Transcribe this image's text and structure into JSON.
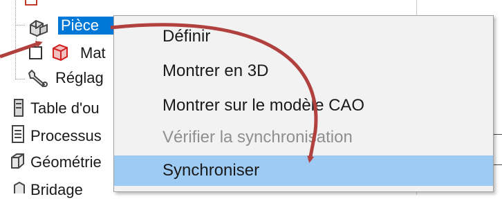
{
  "tree": {
    "selected_label": "Pièce",
    "items": [
      {
        "label": "Mat"
      },
      {
        "label": "Réglag"
      },
      {
        "label": "Table d'ou"
      },
      {
        "label": "Processus"
      },
      {
        "label": "Géométrie"
      },
      {
        "label": "Bridage"
      }
    ]
  },
  "context_menu": {
    "items": [
      {
        "label": "Définir",
        "state": "enabled"
      },
      {
        "label": "Montrer en 3D",
        "state": "enabled"
      },
      {
        "label": "Montrer sur le modèle CAO",
        "state": "enabled"
      },
      {
        "label": "Vérifier la synchronisation",
        "state": "disabled"
      },
      {
        "label": "Synchroniser",
        "state": "highlighted"
      }
    ]
  },
  "colors": {
    "selection": "#0078d7",
    "menu_bg": "#f2f2f2",
    "menu_hover": "#9ecbf3",
    "annotation_arrow": "#b0413e"
  },
  "icons": [
    "part-icon",
    "material-icon",
    "settings-wrench-icon",
    "tool-table-icon",
    "process-list-icon",
    "geometry-icon",
    "clamping-icon"
  ]
}
